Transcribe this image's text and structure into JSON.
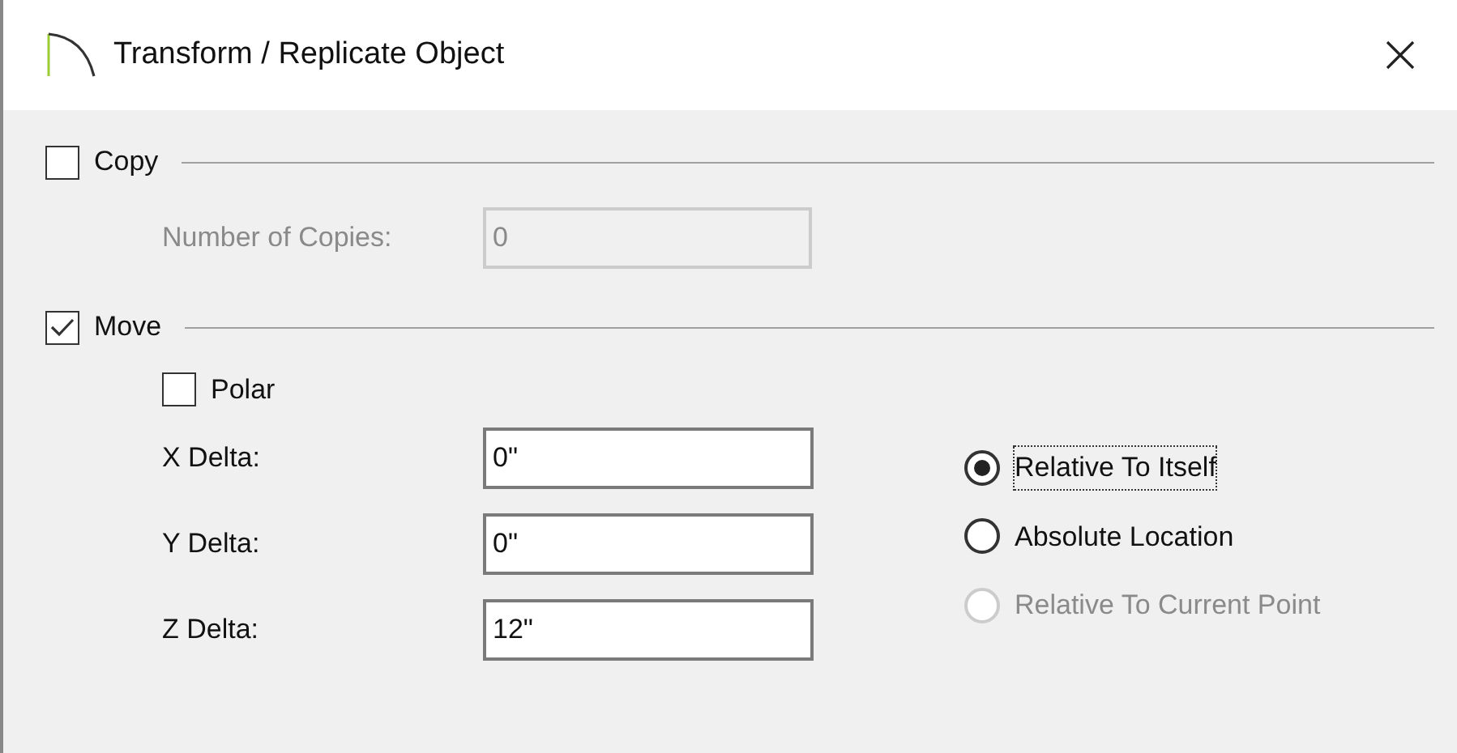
{
  "window": {
    "title": "Transform / Replicate Object"
  },
  "copy": {
    "label": "Copy",
    "checked": false,
    "count_label": "Number of Copies:",
    "count_value": "0",
    "disabled": true
  },
  "move": {
    "label": "Move",
    "checked": true,
    "polar": {
      "label": "Polar",
      "checked": false
    },
    "deltas": [
      {
        "label": "X Delta:",
        "value": "0\""
      },
      {
        "label": "Y Delta:",
        "value": "0\""
      },
      {
        "label": "Z Delta:",
        "value": "12\""
      }
    ],
    "modes": [
      {
        "label": "Relative To Itself",
        "selected": true,
        "disabled": false,
        "focused": true
      },
      {
        "label": "Absolute Location",
        "selected": false,
        "disabled": false,
        "focused": false
      },
      {
        "label": "Relative To Current Point",
        "selected": false,
        "disabled": true,
        "focused": false
      }
    ]
  }
}
